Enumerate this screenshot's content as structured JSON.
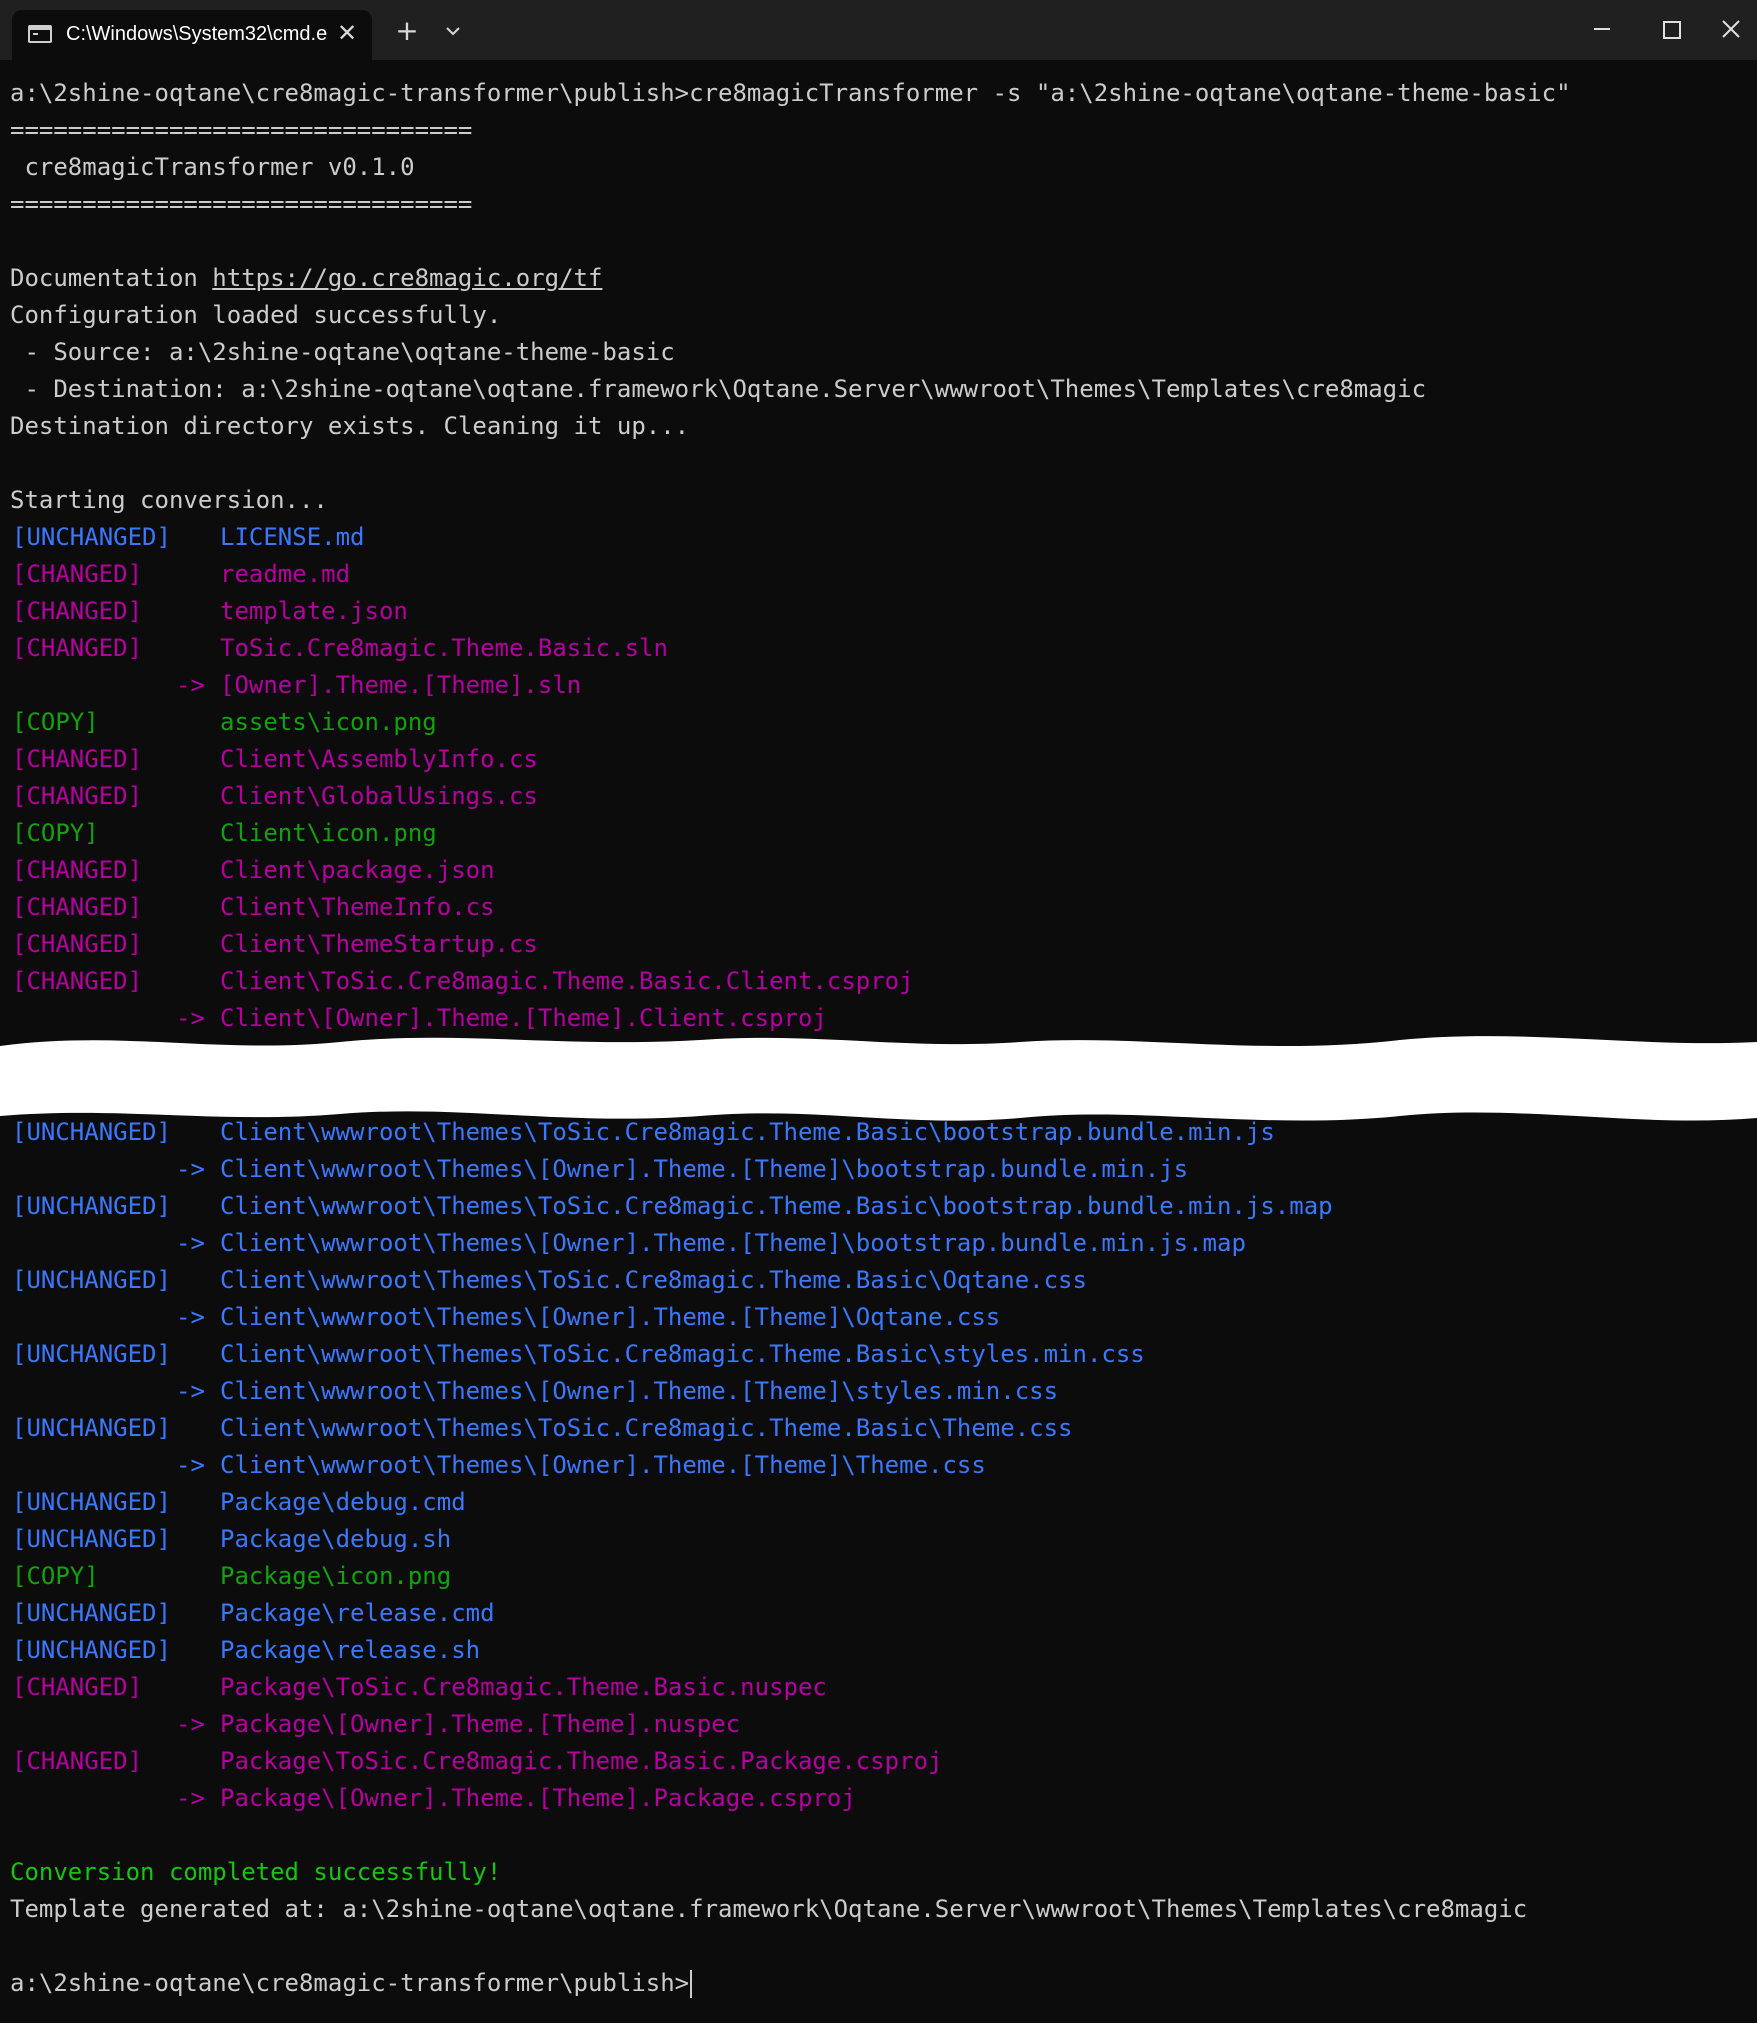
{
  "window": {
    "tab_title": "C:\\Windows\\System32\\cmd.e",
    "new_tab": "+",
    "dropdown": "⌄",
    "close_tab": "✕"
  },
  "top_lines": [
    {
      "kind": "plain",
      "text": "a:\\2shine-oqtane\\cre8magic-transformer\\publish>cre8magicTransformer -s \"a:\\2shine-oqtane\\oqtane-theme-basic\""
    },
    {
      "kind": "plain",
      "text": "================================"
    },
    {
      "kind": "plain",
      "text": " cre8magicTransformer v0.1.0"
    },
    {
      "kind": "plain",
      "text": "================================"
    },
    {
      "kind": "plain",
      "text": ""
    },
    {
      "kind": "doc",
      "text": "Documentation ",
      "link": "https://go.cre8magic.org/tf"
    },
    {
      "kind": "plain",
      "text": "Configuration loaded successfully."
    },
    {
      "kind": "plain",
      "text": " - Source: a:\\2shine-oqtane\\oqtane-theme-basic"
    },
    {
      "kind": "plain",
      "text": " - Destination: a:\\2shine-oqtane\\oqtane.framework\\Oqtane.Server\\wwwroot\\Themes\\Templates\\cre8magic"
    },
    {
      "kind": "plain",
      "text": "Destination directory exists. Cleaning it up..."
    },
    {
      "kind": "plain",
      "text": ""
    },
    {
      "kind": "plain",
      "text": "Starting conversion..."
    },
    {
      "kind": "entry",
      "tag": "[UNCHANGED]",
      "file": "LICENSE.md",
      "color": "blue"
    },
    {
      "kind": "entry",
      "tag": "[CHANGED]",
      "file": "readme.md",
      "color": "mag"
    },
    {
      "kind": "entry",
      "tag": "[CHANGED]",
      "file": "template.json",
      "color": "mag"
    },
    {
      "kind": "entry",
      "tag": "[CHANGED]",
      "file": "ToSic.Cre8magic.Theme.Basic.sln",
      "color": "mag"
    },
    {
      "kind": "arrow",
      "file": "[Owner].Theme.[Theme].sln",
      "color": "mag"
    },
    {
      "kind": "entry",
      "tag": "[COPY]",
      "file": "assets\\icon.png",
      "color": "green"
    },
    {
      "kind": "entry",
      "tag": "[CHANGED]",
      "file": "Client\\AssemblyInfo.cs",
      "color": "mag"
    },
    {
      "kind": "entry",
      "tag": "[CHANGED]",
      "file": "Client\\GlobalUsings.cs",
      "color": "mag"
    },
    {
      "kind": "entry",
      "tag": "[COPY]",
      "file": "Client\\icon.png",
      "color": "green"
    },
    {
      "kind": "entry",
      "tag": "[CHANGED]",
      "file": "Client\\package.json",
      "color": "mag"
    },
    {
      "kind": "entry",
      "tag": "[CHANGED]",
      "file": "Client\\ThemeInfo.cs",
      "color": "mag"
    },
    {
      "kind": "entry",
      "tag": "[CHANGED]",
      "file": "Client\\ThemeStartup.cs",
      "color": "mag"
    },
    {
      "kind": "entry",
      "tag": "[CHANGED]",
      "file": "Client\\ToSic.Cre8magic.Theme.Basic.Client.csproj",
      "color": "mag"
    },
    {
      "kind": "arrow",
      "file": "Client\\[Owner].Theme.[Theme].Client.csproj",
      "color": "mag"
    }
  ],
  "bottom_lines": [
    {
      "kind": "entry",
      "tag": "[UNCHANGED]",
      "file": "Client\\wwwroot\\Themes\\ToSic.Cre8magic.Theme.Basic\\bootstrap.bundle.min.js",
      "color": "blue"
    },
    {
      "kind": "arrow",
      "file": "Client\\wwwroot\\Themes\\[Owner].Theme.[Theme]\\bootstrap.bundle.min.js",
      "color": "blue"
    },
    {
      "kind": "entry",
      "tag": "[UNCHANGED]",
      "file": "Client\\wwwroot\\Themes\\ToSic.Cre8magic.Theme.Basic\\bootstrap.bundle.min.js.map",
      "color": "blue"
    },
    {
      "kind": "arrow",
      "file": "Client\\wwwroot\\Themes\\[Owner].Theme.[Theme]\\bootstrap.bundle.min.js.map",
      "color": "blue"
    },
    {
      "kind": "entry",
      "tag": "[UNCHANGED]",
      "file": "Client\\wwwroot\\Themes\\ToSic.Cre8magic.Theme.Basic\\Oqtane.css",
      "color": "blue"
    },
    {
      "kind": "arrow",
      "file": "Client\\wwwroot\\Themes\\[Owner].Theme.[Theme]\\Oqtane.css",
      "color": "blue"
    },
    {
      "kind": "entry",
      "tag": "[UNCHANGED]",
      "file": "Client\\wwwroot\\Themes\\ToSic.Cre8magic.Theme.Basic\\styles.min.css",
      "color": "blue"
    },
    {
      "kind": "arrow",
      "file": "Client\\wwwroot\\Themes\\[Owner].Theme.[Theme]\\styles.min.css",
      "color": "blue"
    },
    {
      "kind": "entry",
      "tag": "[UNCHANGED]",
      "file": "Client\\wwwroot\\Themes\\ToSic.Cre8magic.Theme.Basic\\Theme.css",
      "color": "blue"
    },
    {
      "kind": "arrow",
      "file": "Client\\wwwroot\\Themes\\[Owner].Theme.[Theme]\\Theme.css",
      "color": "blue"
    },
    {
      "kind": "entry",
      "tag": "[UNCHANGED]",
      "file": "Package\\debug.cmd",
      "color": "blue"
    },
    {
      "kind": "entry",
      "tag": "[UNCHANGED]",
      "file": "Package\\debug.sh",
      "color": "blue"
    },
    {
      "kind": "entry",
      "tag": "[COPY]",
      "file": "Package\\icon.png",
      "color": "green"
    },
    {
      "kind": "entry",
      "tag": "[UNCHANGED]",
      "file": "Package\\release.cmd",
      "color": "blue"
    },
    {
      "kind": "entry",
      "tag": "[UNCHANGED]",
      "file": "Package\\release.sh",
      "color": "blue"
    },
    {
      "kind": "entry",
      "tag": "[CHANGED]",
      "file": "Package\\ToSic.Cre8magic.Theme.Basic.nuspec",
      "color": "mag"
    },
    {
      "kind": "arrow",
      "file": "Package\\[Owner].Theme.[Theme].nuspec",
      "color": "mag"
    },
    {
      "kind": "entry",
      "tag": "[CHANGED]",
      "file": "Package\\ToSic.Cre8magic.Theme.Basic.Package.csproj",
      "color": "mag"
    },
    {
      "kind": "arrow",
      "file": "Package\\[Owner].Theme.[Theme].Package.csproj",
      "color": "mag"
    },
    {
      "kind": "plain",
      "text": ""
    },
    {
      "kind": "success",
      "text": "Conversion completed successfully!"
    },
    {
      "kind": "plain",
      "text": "Template generated at: a:\\2shine-oqtane\\oqtane.framework\\Oqtane.Server\\wwwroot\\Themes\\Templates\\cre8magic"
    },
    {
      "kind": "plain",
      "text": ""
    },
    {
      "kind": "prompt",
      "text": "a:\\2shine-oqtane\\cre8magic-transformer\\publish>"
    }
  ],
  "arrow_symbol": "->",
  "colors": {
    "background": "#0c0c0c",
    "titlebar": "#202020",
    "default_text": "#cccccc",
    "unchanged": "#3b78ff",
    "changed": "#b4009e",
    "copy": "#13a10e",
    "success": "#16c60c"
  }
}
